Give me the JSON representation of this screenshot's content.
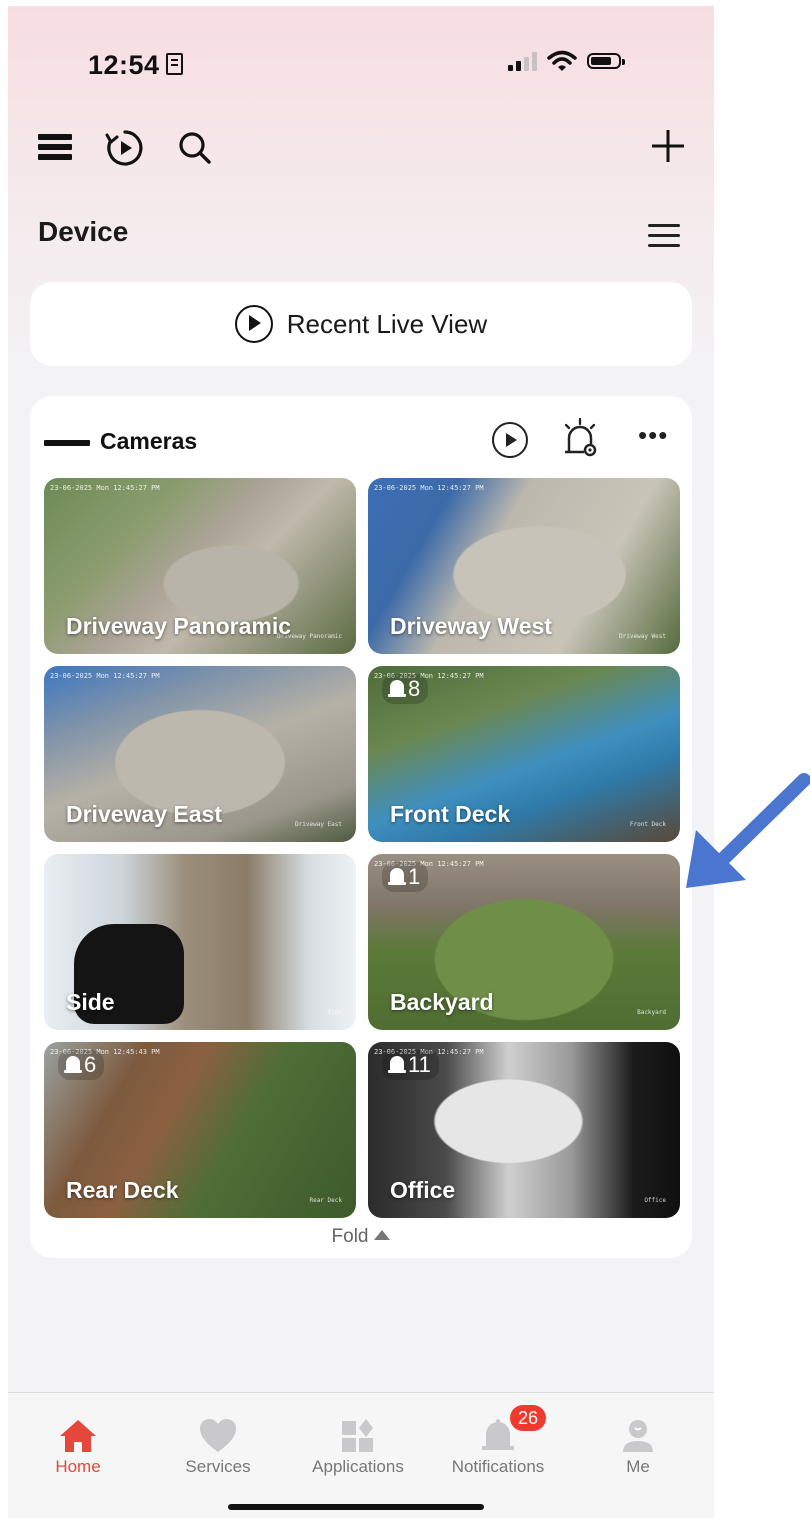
{
  "status_bar": {
    "time": "12:54"
  },
  "header": {
    "section_title": "Device",
    "recent_live_view": "Recent Live View"
  },
  "group": {
    "name": "Cameras",
    "fold_label": "Fold"
  },
  "cameras": [
    {
      "name": "Driveway Panoramic",
      "timestamp": "23-06-2025 Mon 12:45:27 PM",
      "watermark": "Driveway Panoramic",
      "alerts": ""
    },
    {
      "name": "Driveway West",
      "timestamp": "23-06-2025 Mon 12:45:27 PM",
      "watermark": "Driveway West",
      "alerts": ""
    },
    {
      "name": "Driveway East",
      "timestamp": "23-06-2025 Mon 12:45:27 PM",
      "watermark": "Driveway East",
      "alerts": ""
    },
    {
      "name": "Front Deck",
      "timestamp": "23-06-2025 Mon 12:45:27 PM",
      "watermark": "Front Deck",
      "alerts": "8"
    },
    {
      "name": "Side",
      "timestamp": "",
      "watermark": "Side",
      "alerts": ""
    },
    {
      "name": "Backyard",
      "timestamp": "23-06-2025 Mon 12:45:27 PM",
      "watermark": "Backyard",
      "alerts": "1"
    },
    {
      "name": "Rear Deck",
      "timestamp": "23-06-2025 Mon 12:45:43 PM",
      "watermark": "Rear Deck",
      "alerts": "6"
    },
    {
      "name": "Office",
      "timestamp": "23-06-2025 Mon 12:45:27 PM",
      "watermark": "Office",
      "alerts": "11"
    }
  ],
  "tabs": [
    {
      "label": "Home",
      "icon": "home-icon",
      "active": true
    },
    {
      "label": "Services",
      "icon": "heart-icon",
      "active": false
    },
    {
      "label": "Applications",
      "icon": "apps-icon",
      "active": false
    },
    {
      "label": "Notifications",
      "icon": "bell-icon",
      "active": false,
      "badge": "26"
    },
    {
      "label": "Me",
      "icon": "user-icon",
      "active": false
    }
  ],
  "colors": {
    "accent": "#e5473a",
    "badge": "#ef3b2d",
    "annotation_arrow": "#4a76cf"
  }
}
